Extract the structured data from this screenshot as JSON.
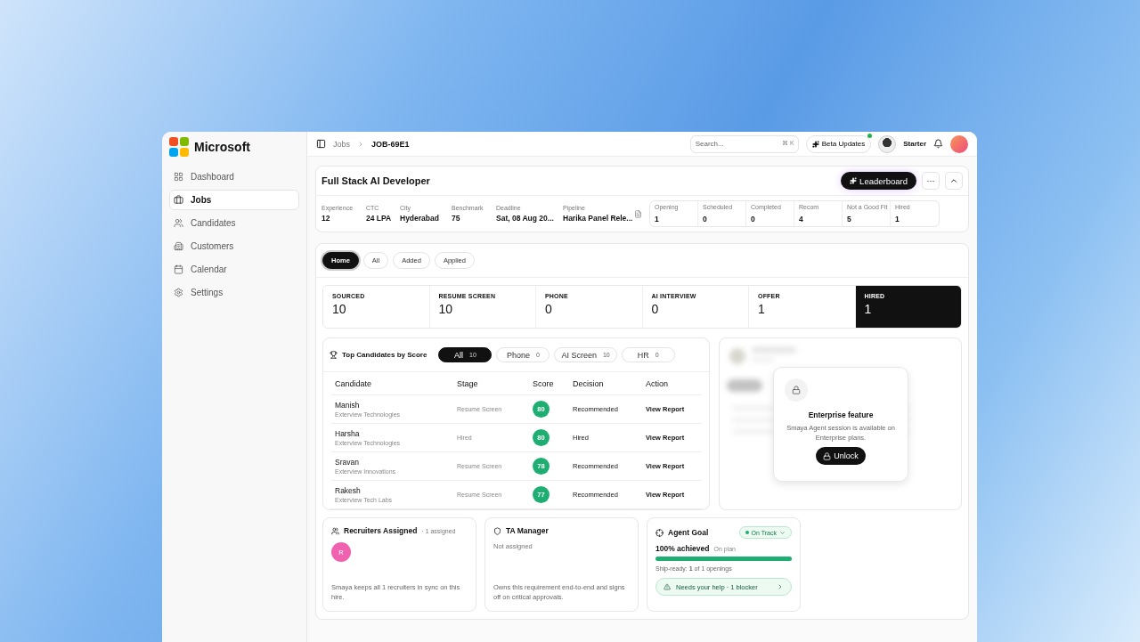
{
  "sidebar": {
    "brand": "Microsoft",
    "items": [
      {
        "label": "Dashboard",
        "selected": false
      },
      {
        "label": "Jobs",
        "selected": true
      },
      {
        "label": "Candidates",
        "selected": false
      },
      {
        "label": "Customers",
        "selected": false
      },
      {
        "label": "Calendar",
        "selected": false
      },
      {
        "label": "Settings",
        "selected": false
      }
    ]
  },
  "header": {
    "breadcrumb": [
      "Jobs",
      "JOB-69E1"
    ],
    "search": {
      "placeholder": "Search...",
      "shortcut": "⌘ K"
    },
    "beta": "Beta Updates",
    "plan": "Starter"
  },
  "job": {
    "title": "Full Stack AI Developer",
    "leaderboard": "Leaderboard",
    "more": "···",
    "details": [
      {
        "label": "Experience",
        "value": "12"
      },
      {
        "label": "CTC",
        "value": "24 LPA"
      },
      {
        "label": "City",
        "value": "Hyderabad"
      },
      {
        "label": "Benchmark",
        "value": "75"
      },
      {
        "label": "Deadline",
        "value": "Sat, 08 Aug 20..."
      },
      {
        "label": "Pipeline",
        "value": "Harika Panel Rele..."
      }
    ],
    "counts": [
      {
        "label": "Opening",
        "value": "1"
      },
      {
        "label": "Scheduled",
        "value": "0"
      },
      {
        "label": "Completed",
        "value": "0"
      },
      {
        "label": "Recom",
        "value": "4"
      },
      {
        "label": "Not a Good Fit",
        "value": "5"
      },
      {
        "label": "Hired",
        "value": "1"
      }
    ]
  },
  "tabs": [
    {
      "label": "Home",
      "selected": true
    },
    {
      "label": "All",
      "selected": false
    },
    {
      "label": "Added",
      "selected": false
    },
    {
      "label": "Applied",
      "selected": false
    }
  ],
  "stages": [
    {
      "label": "SOURCED",
      "value": "10",
      "selected": false
    },
    {
      "label": "RESUME SCREEN",
      "value": "10",
      "selected": false
    },
    {
      "label": "PHONE",
      "value": "0",
      "selected": false
    },
    {
      "label": "AI INTERVIEW",
      "value": "0",
      "selected": false
    },
    {
      "label": "OFFER",
      "value": "1",
      "selected": false
    },
    {
      "label": "HIRED",
      "value": "1",
      "selected": true
    }
  ],
  "top_candidates": {
    "title": "Top Candidates by Score",
    "filters": [
      {
        "label": "All",
        "count": "10",
        "selected": true
      },
      {
        "label": "Phone",
        "count": "0",
        "selected": false
      },
      {
        "label": "AI Screen",
        "count": "10",
        "selected": false
      },
      {
        "label": "HR",
        "count": "0",
        "selected": false
      }
    ],
    "columns": [
      "Candidate",
      "Stage",
      "Score",
      "Decision",
      "Action"
    ],
    "rows": [
      {
        "name": "Manish",
        "company": "Exterview Technologies",
        "stage": "Resume Screen",
        "score": "80",
        "decision": "Recommended",
        "action": "View Report"
      },
      {
        "name": "Harsha",
        "company": "Exterview Technologies",
        "stage": "Hired",
        "score": "80",
        "decision": "Hired",
        "action": "View Report"
      },
      {
        "name": "Sravan",
        "company": "Exterview Innovations",
        "stage": "Resume Screen",
        "score": "78",
        "decision": "Recommended",
        "action": "View Report"
      },
      {
        "name": "Rakesh",
        "company": "Exterview Tech Labs",
        "stage": "Resume Screen",
        "score": "77",
        "decision": "Recommended",
        "action": "View Report"
      }
    ]
  },
  "enterprise": {
    "title": "Enterprise feature",
    "text": "Smaya Agent session is available on Enterprise plans.",
    "button": "Unlock"
  },
  "recruiters": {
    "title": "Recruiters Assigned",
    "count": "· 1 assigned",
    "avatars": [
      {
        "initial": "R",
        "color": "#f062b0"
      }
    ],
    "text": "Smaya keeps all 1 recruiters in sync on this hire."
  },
  "ta_manager": {
    "title": "TA Manager",
    "value": "Not assigned",
    "text": "Owns this requirement end-to-end and signs off on critical approvals."
  },
  "agent_goal": {
    "title": "Agent Goal",
    "status": "On Track",
    "achieved": "100% achieved",
    "plan": "On plan",
    "level": 1,
    "ship": "Ship-ready: **1** of 1 openings",
    "help": "Needs your help · 1 blocker"
  }
}
